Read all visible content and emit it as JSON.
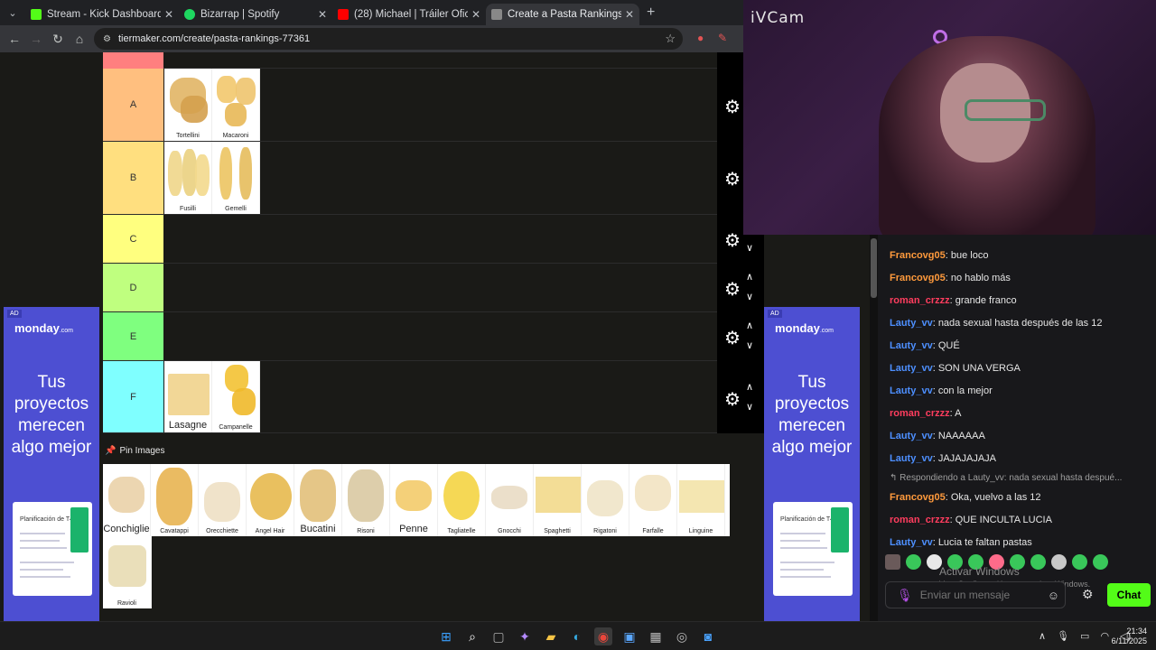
{
  "browser": {
    "tabs": [
      {
        "title": "Stream - Kick Dashboard",
        "favicon_color": "#53fc18"
      },
      {
        "title": "Bizarrap | Spotify",
        "favicon_color": "#1ed760"
      },
      {
        "title": "(28) Michael | Tráiler Oficial - H",
        "favicon_color": "#ff0000"
      },
      {
        "title": "Create a Pasta Rankings Tier Lis",
        "favicon_color": "#888888"
      }
    ],
    "url": "tiermaker.com/create/pasta-rankings-77361"
  },
  "tiers": [
    {
      "label": "A",
      "color": "#ffbf7f",
      "items": [
        {
          "name": "Tortellini"
        },
        {
          "name": "Macaroni"
        }
      ]
    },
    {
      "label": "B",
      "color": "#ffdf7f",
      "items": [
        {
          "name": "Fusilli"
        },
        {
          "name": "Gemelli"
        }
      ]
    },
    {
      "label": "C",
      "color": "#ffff7f",
      "items": []
    },
    {
      "label": "D",
      "color": "#bfff7f",
      "items": []
    },
    {
      "label": "E",
      "color": "#7fff7f",
      "items": []
    },
    {
      "label": "F",
      "color": "#7fffff",
      "items": [
        {
          "name": "Lasagne"
        },
        {
          "name": "Campanelle"
        }
      ]
    }
  ],
  "pin_images_label": "Pin Images",
  "pool_items": [
    "Conchiglie",
    "Cavatappi",
    "Orecchiette",
    "Angel Hair",
    "Bucatini",
    "Risoni",
    "Penne",
    "Tagliatelle",
    "Gnocchi",
    "Spaghetti",
    "Rigatoni",
    "Farfalle",
    "Linguine",
    "Ravioli"
  ],
  "ad": {
    "tag": "AD",
    "brand": "monday",
    "brand_suffix": ".com",
    "headline": "Tus proyectos merecen algo mejor",
    "screenshot_title": "Planificación de T4"
  },
  "webcam": {
    "brand": "iVCam"
  },
  "chat": {
    "messages": [
      {
        "user": "Francovg05",
        "text": ": bue loco",
        "color": "#ff9a3c"
      },
      {
        "user": "Francovg05",
        "text": ": no hablo más",
        "color": "#ff9a3c"
      },
      {
        "user": "roman_crzzz",
        "text": ": grande franco",
        "color": "#ff3d5e"
      },
      {
        "user": "Lauty_vv",
        "text": ": nada sexual hasta después de las 12",
        "color": "#4d8fff"
      },
      {
        "user": "Lauty_vv",
        "text": ": QUÉ",
        "color": "#4d8fff"
      },
      {
        "user": "Lauty_vv",
        "text": ": SON UNA VERGA",
        "color": "#4d8fff"
      },
      {
        "user": "Lauty_vv",
        "text": ": con la mejor",
        "color": "#4d8fff"
      },
      {
        "user": "roman_crzzz",
        "text": ": A",
        "color": "#ff3d5e"
      },
      {
        "user": "Lauty_vv",
        "text": ": NAAAAAA",
        "color": "#4d8fff"
      },
      {
        "user": "Lauty_vv",
        "text": ": JAJAJAJAJA",
        "color": "#4d8fff"
      }
    ],
    "reply_note": "↰ Respondiendo a Lauty_vv: nada sexual hasta despué...",
    "messages2": [
      {
        "user": "Francovg05",
        "text": ": Oka, vuelvo a las 12",
        "color": "#ff9a3c"
      },
      {
        "user": "roman_crzzz",
        "text": ": QUE INCULTA LUCIA",
        "color": "#ff3d5e"
      },
      {
        "user": "Lauty_vv",
        "text": ": Lucia te faltan pastas",
        "color": "#4d8fff"
      }
    ],
    "input_placeholder": "Enviar un mensaje",
    "send_label": "Chat",
    "watermark_line1": "Activar Windows",
    "watermark_line2": "Ve a Configuración para activar Windows."
  },
  "taskbar": {
    "time": "21:34",
    "date": "6/11/2025"
  }
}
